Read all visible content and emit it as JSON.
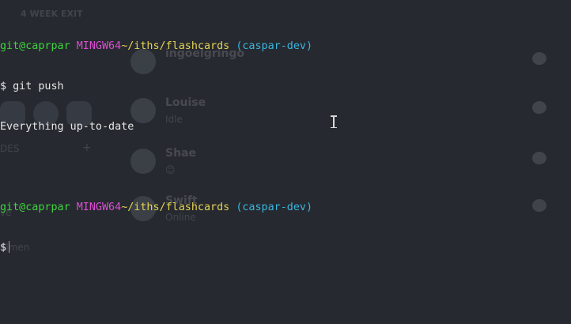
{
  "background_app": {
    "header_text": "4 WEEK EXIT",
    "friends": [
      {
        "name": "ingoelgringo",
        "status": ""
      },
      {
        "name": "Louise",
        "status": "Idle"
      },
      {
        "name": "Shae",
        "status": "😊"
      },
      {
        "name": "Swift",
        "status": "Online"
      }
    ],
    "sidebar_labels": [
      "DES",
      "ve",
      "almen"
    ]
  },
  "terminal": {
    "lines": [
      {
        "type": "prompt",
        "user": "git@caprpar",
        "env": "MINGW64",
        "path": "~/iths/flashcards",
        "branch": "(caspar-dev)"
      },
      {
        "type": "command",
        "symbol": "$",
        "text": "git push"
      },
      {
        "type": "output",
        "text": "Everything up-to-date"
      },
      {
        "type": "blank"
      },
      {
        "type": "prompt",
        "user": "git@caprpar",
        "env": "MINGW64",
        "path": "~/iths/flashcards",
        "branch": "(caspar-dev)"
      },
      {
        "type": "input",
        "symbol": "$",
        "text": ""
      }
    ]
  },
  "colors": {
    "background": "#26292f",
    "user": "#3fd43f",
    "env": "#d94fd1",
    "path": "#e4d452",
    "branch": "#3ab5de",
    "text": "#e6e6e6"
  },
  "pointer": {
    "icon": "ibeam-cursor-icon"
  }
}
